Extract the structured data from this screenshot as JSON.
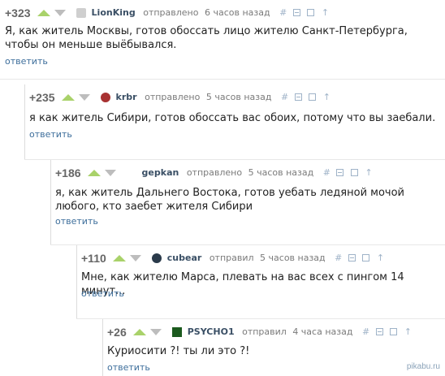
{
  "comments": [
    {
      "rating": "+323",
      "author": "LionKing",
      "action": "отправлено",
      "time": "6 часов назад",
      "text": "Я, как житель Москвы, готов обоссать лицо жителю Санкт-Петербурга, чтобы он меньше выёбывался.",
      "reply": "ответить",
      "avatar_icon": "lion-avatar"
    },
    {
      "rating": "+235",
      "author": "krbr",
      "action": "отправлено",
      "time": "5 часов назад",
      "text": "я как житель Сибири, готов обоссать вас обоих, потому что вы заебали.",
      "reply": "ответить",
      "avatar_icon": "krbr-avatar"
    },
    {
      "rating": "+186",
      "author": "gepkan",
      "action": "отправлено",
      "time": "5 часов назад",
      "text": "я, как житель Дальнего Востока, готов уебать ледяной мочой любого, кто заебет жителя Сибири",
      "reply": "ответить",
      "avatar_icon": "gepkan-avatar"
    },
    {
      "rating": "+110",
      "author": "cubear",
      "action": "отправил",
      "time": "5 часов назад",
      "text": "Мне, как жителю Марса, плевать на вас всех с пингом 14 минут...",
      "reply": "ответить",
      "avatar_icon": "cubear-avatar"
    },
    {
      "rating": "+26",
      "author": "PSYCHO1",
      "action": "отправил",
      "time": "4 часа назад",
      "text": "Куриосити ?! ты ли это ?!",
      "reply": "ответить",
      "avatar_icon": "psycho1-avatar"
    }
  ],
  "icons": {
    "link": "#",
    "collapse": "⊟",
    "save": "save-icon",
    "parent": "↑"
  },
  "watermark": "pikabu.ru",
  "colors": {
    "upvote": "#a9d26a",
    "downvote": "#bdbdbd",
    "link": "#3d6e9b",
    "author": "#3a4f65"
  }
}
